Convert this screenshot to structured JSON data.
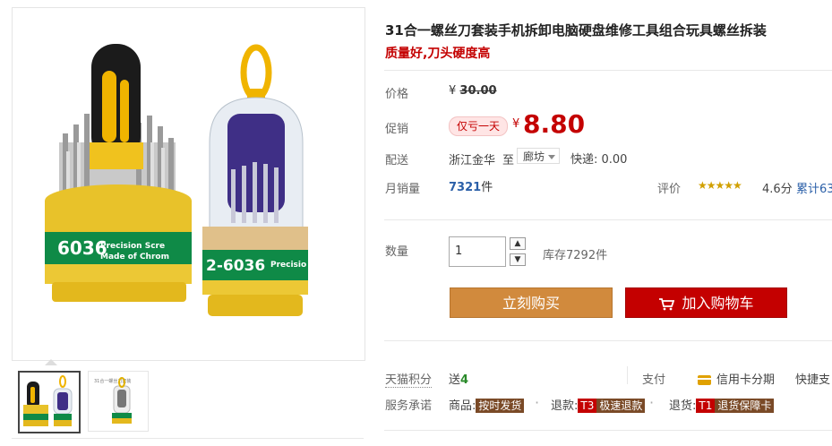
{
  "product": {
    "title": "31合一螺丝刀套装手机拆卸电脑硬盘维修工具组合玩具螺丝拆装",
    "subtitle": "质量好,刀头硬度高"
  },
  "price": {
    "label": "价格",
    "currency": "¥",
    "original": "30.00"
  },
  "promo": {
    "label": "促销",
    "badge": "仅亏一天",
    "currency": "¥",
    "price": "8.80"
  },
  "shipping": {
    "label": "配送",
    "from": "浙江金华",
    "to_word": "至",
    "destination": "廊坊",
    "fee": "快递: 0.00"
  },
  "sales": {
    "label": "月销量",
    "count": "7321",
    "unit": "件"
  },
  "rating": {
    "label": "评价",
    "stars": "★★★★★",
    "score": "4.6分",
    "total_prefix": "累计63"
  },
  "quantity": {
    "label": "数量",
    "value": "1",
    "stock": "库存7292件"
  },
  "buttons": {
    "buy_now": "立刻购买",
    "add_cart": "加入购物车"
  },
  "points": {
    "label": "天猫积分",
    "value_prefix": "送",
    "value": "4"
  },
  "payment": {
    "label": "支付",
    "credit": "信用卡分期",
    "quick": "快捷支"
  },
  "service": {
    "label": "服务承诺",
    "goods_label": "商品:",
    "goods_tag": "按时发货",
    "refund_label": "退款:",
    "refund_code": "T3",
    "refund_tag": "极速退款",
    "return_label": "退货:",
    "return_code": "T1",
    "return_tag": "退货保障卡"
  },
  "images": {
    "left_code": "6036",
    "right_code": "2-6036",
    "band_text_1": "Precision Scre",
    "band_text_2": "Made of Chrom",
    "right_band_text": "Precisio",
    "thumb2_caption": "31合一螺丝刀套装"
  },
  "colors": {
    "price_red": "#c40000",
    "buy_orange": "#d18a3d",
    "cart_red": "#c40000",
    "link_blue": "#2a5fa8",
    "yellow_plastic": "#e8c22a",
    "green_band": "#0f8a47"
  }
}
